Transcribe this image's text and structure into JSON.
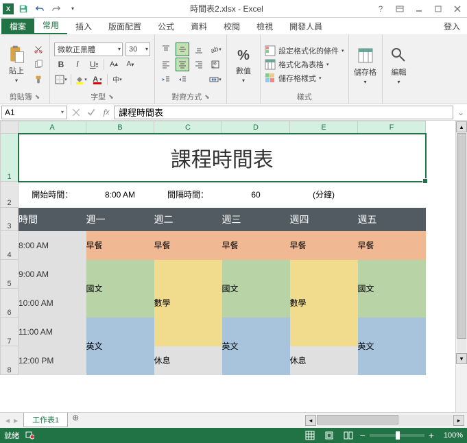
{
  "titlebar": {
    "title": "時間表2.xlsx - Excel"
  },
  "tabs": {
    "file": "檔案",
    "list": [
      "常用",
      "插入",
      "版面配置",
      "公式",
      "資料",
      "校閱",
      "檢視",
      "開發人員"
    ],
    "active": 0,
    "signin": "登入"
  },
  "ribbon": {
    "clipboard": {
      "paste": "貼上",
      "label": "剪貼簿"
    },
    "font": {
      "name": "微軟正黑體",
      "size": "30",
      "bold": "B",
      "italic": "I",
      "underline": "U",
      "label": "字型"
    },
    "alignment": {
      "label": "對齊方式"
    },
    "number": {
      "fmt": "%",
      "label": "數值"
    },
    "styles": {
      "cond": "設定格式化的條件",
      "table": "格式化為表格",
      "cell": "儲存格樣式",
      "label": "樣式"
    },
    "cells": {
      "label": "儲存格"
    },
    "editing": {
      "label": "編輯"
    }
  },
  "formulaBar": {
    "nameBox": "A1",
    "formula": "課程時間表"
  },
  "columns": [
    "A",
    "B",
    "C",
    "D",
    "E",
    "F"
  ],
  "rowNums": [
    1,
    2,
    3,
    4,
    5,
    6,
    7,
    8
  ],
  "sheet": {
    "title": "課程時間表",
    "startLabel": "開始時間：",
    "startTime": "8:00 AM",
    "intervalLabel": "間隔時間：",
    "interval": "60",
    "minutes": "(分鐘)",
    "headers": [
      "時間",
      "週一",
      "週二",
      "週三",
      "週四",
      "週五"
    ],
    "times": [
      "8:00 AM",
      "9:00 AM",
      "10:00 AM",
      "11:00 AM",
      "12:00 PM"
    ],
    "row8am": [
      "早餐",
      "早餐",
      "早餐",
      "早餐",
      "早餐"
    ],
    "guowen": "國文",
    "shuxue": "數學",
    "yingwen": "英文",
    "xiuxi": "休息"
  },
  "sheetTab": "工作表1",
  "status": {
    "ready": "就緒",
    "zoom": "100%"
  }
}
